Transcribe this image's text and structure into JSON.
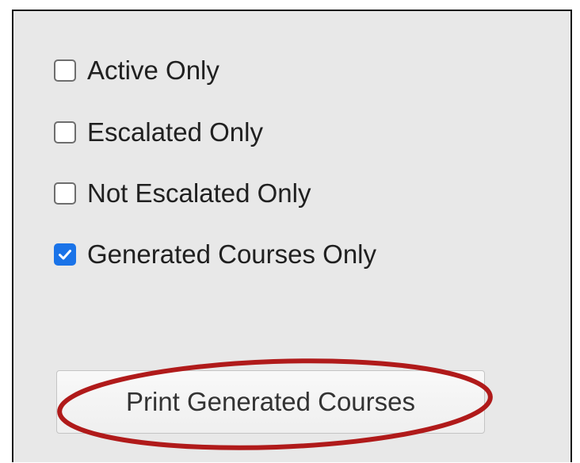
{
  "filters": {
    "items": [
      {
        "label": "Active Only",
        "checked": false
      },
      {
        "label": "Escalated Only",
        "checked": false
      },
      {
        "label": "Not Escalated Only",
        "checked": false
      },
      {
        "label": "Generated Courses Only",
        "checked": true
      }
    ]
  },
  "actions": {
    "print_label": "Print Generated Courses"
  },
  "annotation": {
    "highlight_color": "#b01a1a",
    "highlight_target": "print-generated-courses-button"
  },
  "colors": {
    "panel_background": "#e8e8e8",
    "checkbox_checked": "#1a73e8"
  }
}
